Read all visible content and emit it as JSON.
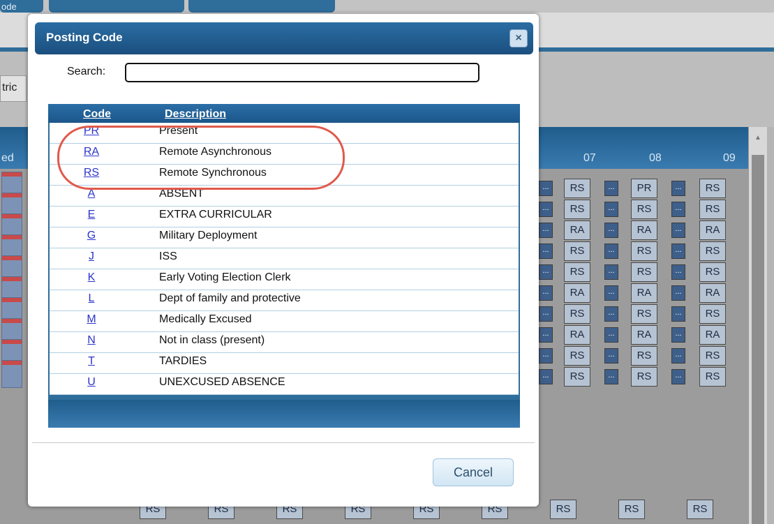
{
  "background": {
    "tab_fragment": "ode",
    "sub_fragment": "tric",
    "header_fragment": "ed",
    "period_headers": [
      "07",
      "08",
      "09"
    ],
    "grid_rows": [
      [
        "RS",
        "PR",
        "RS"
      ],
      [
        "RS",
        "RS",
        "RS"
      ],
      [
        "RA",
        "RA",
        "RA"
      ],
      [
        "RS",
        "RS",
        "RS"
      ],
      [
        "RS",
        "RS",
        "RS"
      ],
      [
        "RA",
        "RA",
        "RA"
      ],
      [
        "RS",
        "RS",
        "RS"
      ],
      [
        "RA",
        "RA",
        "RA"
      ],
      [
        "RS",
        "RS",
        "RS"
      ],
      [
        "RS",
        "RS",
        "RS"
      ]
    ],
    "bottom_row": [
      "RS",
      "RS",
      "RS",
      "RS",
      "RS",
      "RS",
      "RS",
      "RS",
      "RS"
    ],
    "dots_label": "..."
  },
  "dialog": {
    "title": "Posting Code",
    "close_label": "×",
    "search_label": "Search:",
    "search_value": "",
    "table": {
      "headers": {
        "code": "Code",
        "description": "Description"
      },
      "rows": [
        {
          "code": "PR",
          "description": "Present"
        },
        {
          "code": "RA",
          "description": "Remote Asynchronous"
        },
        {
          "code": "RS",
          "description": "Remote Synchronous"
        },
        {
          "code": "A",
          "description": "ABSENT"
        },
        {
          "code": "E",
          "description": "EXTRA CURRICULAR"
        },
        {
          "code": "G",
          "description": "Military Deployment"
        },
        {
          "code": "J",
          "description": "ISS"
        },
        {
          "code": "K",
          "description": "Early Voting Election Clerk"
        },
        {
          "code": "L",
          "description": "Dept of family and protective"
        },
        {
          "code": "M",
          "description": "Medically Excused"
        },
        {
          "code": "N",
          "description": "Not in class (present)"
        },
        {
          "code": "T",
          "description": "TARDIES"
        },
        {
          "code": "U",
          "description": "UNEXCUSED ABSENCE"
        }
      ]
    },
    "cancel_label": "Cancel"
  },
  "colors": {
    "title_bar": "#1f5d8c",
    "link": "#2c34c8",
    "highlight_ring": "#e05a4c"
  }
}
